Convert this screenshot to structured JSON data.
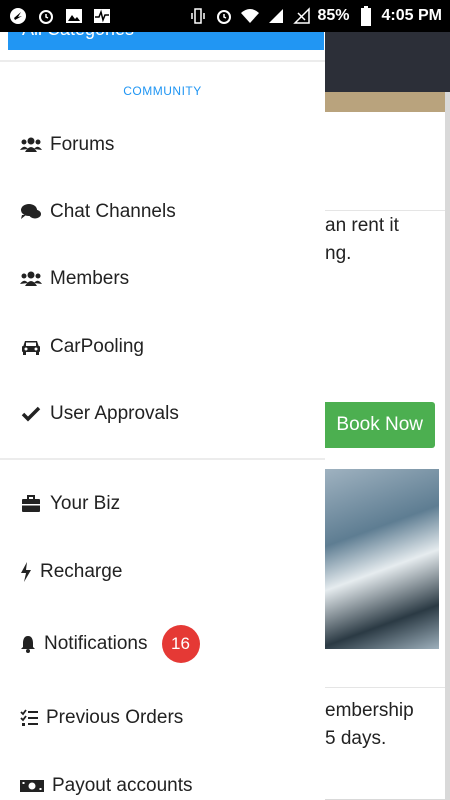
{
  "status_bar": {
    "battery": "85%",
    "time": "4:05 PM",
    "icons": [
      "app-icon",
      "alarm-icon",
      "image-icon",
      "activity-icon",
      "vibrate-icon",
      "alarm-icon",
      "wifi-icon",
      "signal-icon",
      "signal-off-icon",
      "battery-icon"
    ]
  },
  "background": {
    "card1_text_line1": "an rent it",
    "card1_text_line2": "ng.",
    "book_now": "Book Now",
    "card2_text_line1": "embership",
    "card2_text_line2": "5 days."
  },
  "drawer": {
    "all_categories": "All Categories",
    "section_title": "COMMUNITY",
    "community_items": [
      {
        "label": "Forums",
        "icon": "users-icon"
      },
      {
        "label": "Chat Channels",
        "icon": "chat-icon"
      },
      {
        "label": "Members",
        "icon": "users-icon"
      },
      {
        "label": "CarPooling",
        "icon": "car-icon"
      },
      {
        "label": "User Approvals",
        "icon": "check-icon"
      }
    ],
    "other_items": [
      {
        "label": "Your Biz",
        "icon": "briefcase-icon"
      },
      {
        "label": "Recharge",
        "icon": "bolt-icon"
      },
      {
        "label": "Notifications",
        "icon": "bell-icon",
        "badge": "16"
      },
      {
        "label": "Previous Orders",
        "icon": "checklist-icon"
      },
      {
        "label": "Payout accounts",
        "icon": "money-icon"
      }
    ]
  },
  "colors": {
    "accent": "#2196f3",
    "badge": "#e53935",
    "book_button": "#4caf50"
  }
}
